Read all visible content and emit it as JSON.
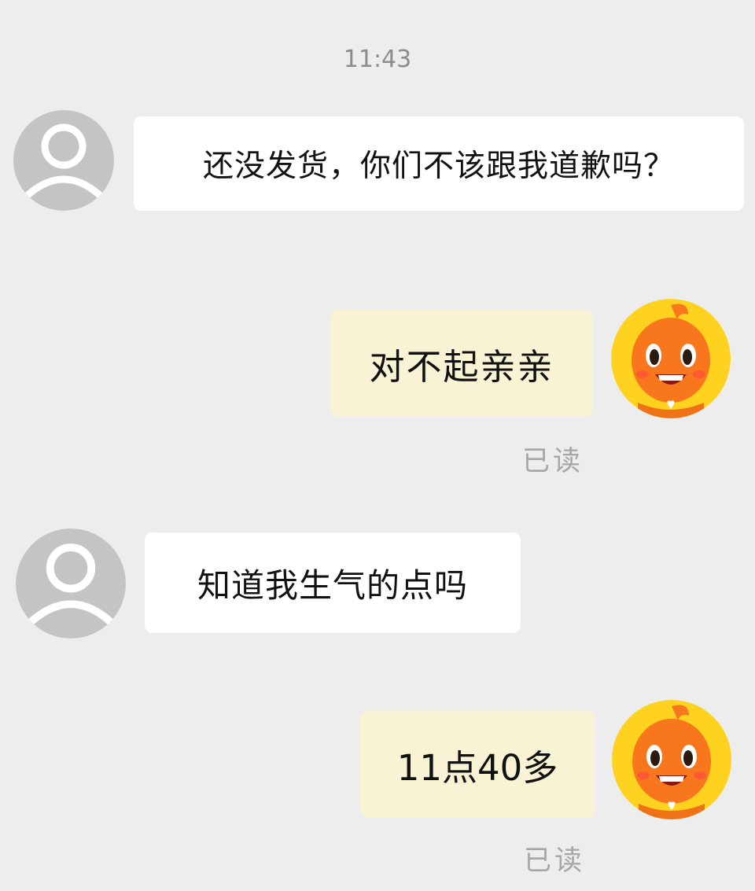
{
  "chat": {
    "timestamp": "11:43",
    "messages": [
      {
        "side": "left",
        "text": "还没发货，你们不该跟我道歉吗？"
      },
      {
        "side": "right",
        "text": "对不起亲亲",
        "status": "已读"
      },
      {
        "side": "left",
        "text": "知道我生气的点吗"
      },
      {
        "side": "right",
        "text": "11点40多",
        "status": "已读"
      }
    ]
  },
  "colors": {
    "background": "#ededed",
    "customer_bubble": "#ffffff",
    "agent_bubble": "#f8f3d4",
    "read_status": "#a6a6a6",
    "agent_avatar_bg": "#ffd21f",
    "agent_mascot": "#f8761c"
  }
}
